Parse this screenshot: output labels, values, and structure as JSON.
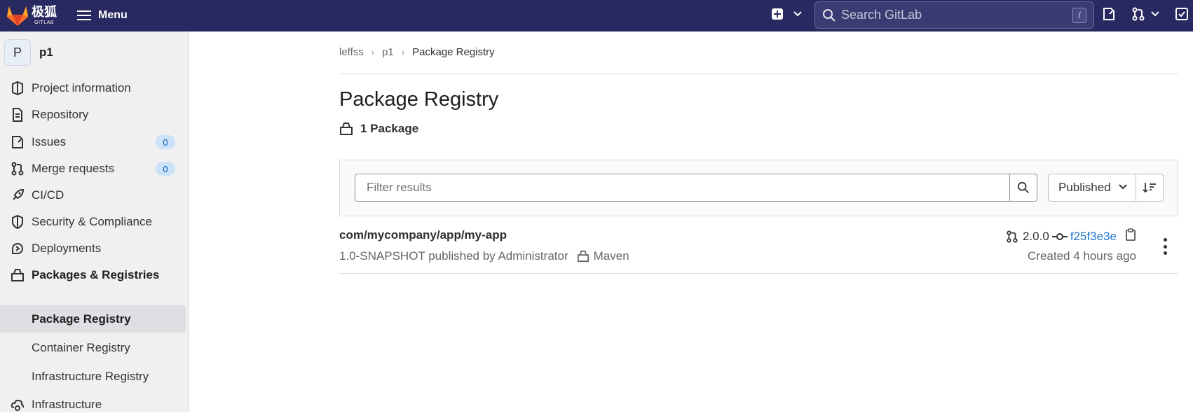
{
  "brand": {
    "name_cn": "极狐",
    "name_en": "GITLAB",
    "color": "#292961"
  },
  "topbar": {
    "menu_label": "Menu",
    "search_placeholder": "Search GitLab",
    "search_shortcut": "/"
  },
  "sidebar": {
    "project_initial": "P",
    "project_name": "p1",
    "items": [
      {
        "label": "Project information",
        "icon": "project-icon"
      },
      {
        "label": "Repository",
        "icon": "document-icon"
      },
      {
        "label": "Issues",
        "icon": "issues-icon",
        "count": "0"
      },
      {
        "label": "Merge requests",
        "icon": "merge-request-icon",
        "count": "0"
      },
      {
        "label": "CI/CD",
        "icon": "rocket-icon"
      },
      {
        "label": "Security & Compliance",
        "icon": "shield-icon"
      },
      {
        "label": "Deployments",
        "icon": "deployments-icon"
      },
      {
        "label": "Packages & Registries",
        "icon": "package-icon"
      }
    ],
    "sub_items": [
      {
        "label": "Package Registry",
        "active": true
      },
      {
        "label": "Container Registry"
      },
      {
        "label": "Infrastructure Registry"
      }
    ],
    "next_item": {
      "label": "Infrastructure",
      "icon": "cloud-gear-icon"
    }
  },
  "breadcrumb": {
    "items": [
      "leffss",
      "p1"
    ],
    "current": "Package Registry"
  },
  "page": {
    "title": "Package Registry",
    "package_count": "1 Package"
  },
  "filter": {
    "placeholder": "Filter results",
    "sort_label": "Published"
  },
  "packages": [
    {
      "name": "com/mycompany/app/my-app",
      "version_meta": "1.0-SNAPSHOT published by Administrator",
      "type": "Maven",
      "branch_version": "2.0.0",
      "commit_sha": "f25f3e3e",
      "created": "Created 4 hours ago"
    }
  ]
}
